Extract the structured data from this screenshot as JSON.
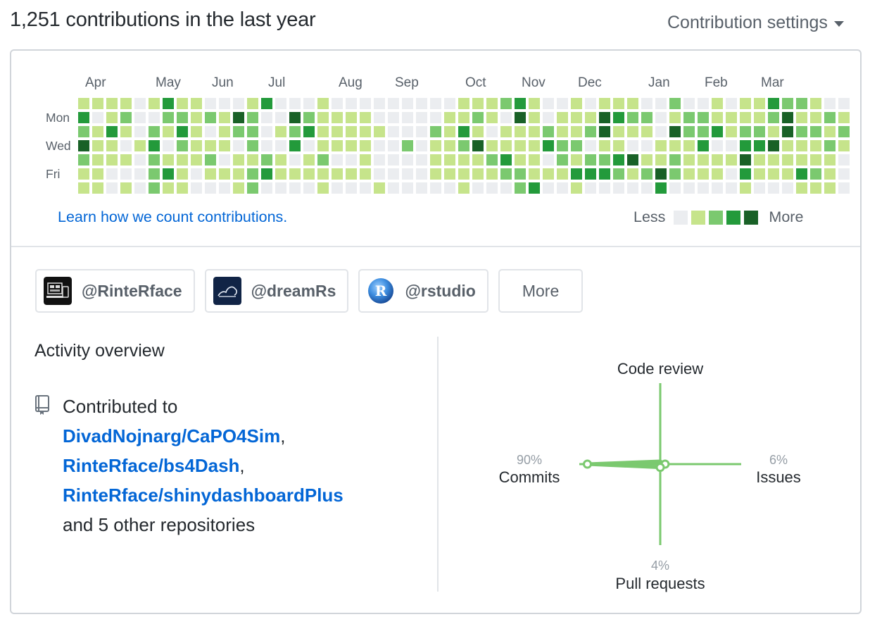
{
  "header": {
    "title": "1,251 contributions in the last year",
    "settings_label": "Contribution settings"
  },
  "calendar": {
    "months": [
      {
        "label": "Apr",
        "week": 1
      },
      {
        "label": "May",
        "week": 6
      },
      {
        "label": "Jun",
        "week": 10
      },
      {
        "label": "Jul",
        "week": 14
      },
      {
        "label": "Aug",
        "week": 19
      },
      {
        "label": "Sep",
        "week": 23
      },
      {
        "label": "Oct",
        "week": 28
      },
      {
        "label": "Nov",
        "week": 32
      },
      {
        "label": "Dec",
        "week": 36
      },
      {
        "label": "Jan",
        "week": 41
      },
      {
        "label": "Feb",
        "week": 45
      },
      {
        "label": "Mar",
        "week": 49
      }
    ],
    "day_labels": [
      {
        "label": "Mon",
        "row": 1
      },
      {
        "label": "Wed",
        "row": 3
      },
      {
        "label": "Fri",
        "row": 5
      }
    ],
    "level_colors": [
      "#ebedf0",
      "#c6e48b",
      "#7bc96f",
      "#239a3b",
      "#196127"
    ],
    "weeks": [
      [
        1,
        3,
        2,
        4,
        2,
        1,
        1
      ],
      [
        1,
        0,
        1,
        1,
        1,
        1,
        1
      ],
      [
        1,
        1,
        3,
        1,
        1,
        0,
        0
      ],
      [
        1,
        2,
        1,
        0,
        1,
        0,
        1
      ],
      [
        0,
        0,
        0,
        1,
        0,
        0,
        0
      ],
      [
        1,
        0,
        2,
        3,
        2,
        2,
        2
      ],
      [
        3,
        2,
        1,
        0,
        1,
        3,
        1
      ],
      [
        1,
        2,
        3,
        2,
        1,
        1,
        1
      ],
      [
        1,
        1,
        1,
        1,
        1,
        0,
        0
      ],
      [
        0,
        2,
        0,
        1,
        2,
        1,
        0
      ],
      [
        0,
        1,
        1,
        1,
        0,
        1,
        0
      ],
      [
        0,
        4,
        2,
        0,
        1,
        1,
        1
      ],
      [
        1,
        2,
        2,
        2,
        1,
        2,
        2
      ],
      [
        3,
        0,
        0,
        0,
        2,
        3,
        0
      ],
      [
        0,
        0,
        1,
        0,
        1,
        1,
        0
      ],
      [
        0,
        4,
        2,
        3,
        0,
        1,
        0
      ],
      [
        0,
        2,
        3,
        0,
        1,
        1,
        0
      ],
      [
        1,
        1,
        1,
        1,
        2,
        1,
        1
      ],
      [
        0,
        1,
        1,
        1,
        0,
        1,
        0
      ],
      [
        0,
        1,
        1,
        1,
        0,
        1,
        0
      ],
      [
        0,
        1,
        1,
        1,
        1,
        1,
        0
      ],
      [
        0,
        0,
        1,
        0,
        0,
        0,
        1
      ],
      [
        0,
        0,
        0,
        0,
        0,
        0,
        0
      ],
      [
        0,
        0,
        0,
        2,
        0,
        0,
        0
      ],
      [
        0,
        0,
        0,
        0,
        0,
        0,
        0
      ],
      [
        0,
        0,
        2,
        1,
        1,
        1,
        0
      ],
      [
        0,
        1,
        1,
        1,
        1,
        1,
        0
      ],
      [
        1,
        1,
        3,
        2,
        1,
        1,
        1
      ],
      [
        1,
        2,
        1,
        4,
        1,
        1,
        0
      ],
      [
        1,
        1,
        0,
        1,
        2,
        1,
        0
      ],
      [
        2,
        0,
        1,
        1,
        3,
        2,
        0
      ],
      [
        3,
        4,
        1,
        1,
        1,
        2,
        2
      ],
      [
        1,
        1,
        1,
        1,
        1,
        1,
        3
      ],
      [
        0,
        0,
        2,
        3,
        0,
        1,
        0
      ],
      [
        0,
        1,
        1,
        2,
        2,
        1,
        0
      ],
      [
        1,
        1,
        1,
        2,
        1,
        3,
        1
      ],
      [
        0,
        1,
        2,
        0,
        2,
        3,
        0
      ],
      [
        1,
        4,
        4,
        1,
        2,
        3,
        0
      ],
      [
        1,
        3,
        1,
        1,
        3,
        2,
        0
      ],
      [
        1,
        2,
        1,
        0,
        4,
        1,
        0
      ],
      [
        0,
        2,
        1,
        0,
        1,
        2,
        0
      ],
      [
        0,
        0,
        0,
        1,
        1,
        4,
        3
      ],
      [
        2,
        1,
        4,
        1,
        2,
        2,
        0
      ],
      [
        0,
        2,
        2,
        1,
        1,
        1,
        0
      ],
      [
        0,
        2,
        2,
        3,
        1,
        1,
        0
      ],
      [
        1,
        1,
        3,
        0,
        1,
        1,
        0
      ],
      [
        0,
        1,
        1,
        0,
        1,
        0,
        0
      ],
      [
        1,
        1,
        2,
        3,
        4,
        3,
        1
      ],
      [
        1,
        1,
        2,
        3,
        1,
        1,
        0
      ],
      [
        3,
        2,
        1,
        4,
        1,
        1,
        0
      ],
      [
        2,
        4,
        4,
        1,
        1,
        1,
        0
      ],
      [
        2,
        1,
        2,
        1,
        1,
        3,
        1
      ],
      [
        1,
        1,
        2,
        1,
        1,
        2,
        1
      ],
      [
        0,
        2,
        1,
        2,
        1,
        1,
        1
      ],
      [
        0,
        1,
        2,
        1,
        0,
        0,
        0
      ]
    ]
  },
  "footer_row": {
    "learn_link": "Learn how we count contributions.",
    "less_label": "Less",
    "more_label": "More"
  },
  "orgs": [
    {
      "label": "@RinteRface",
      "avatar": "rinterface-avatar"
    },
    {
      "label": "@dreamRs",
      "avatar": "dreamrs-avatar"
    },
    {
      "label": "@rstudio",
      "avatar": "rstudio-avatar"
    }
  ],
  "orgs_more_label": "More",
  "activity": {
    "title": "Activity overview",
    "contributed_to": "Contributed to",
    "repos": [
      "DivadNojnarg/CaPO4Sim",
      "RinteRface/bs4Dash",
      "RinteRface/shinydashboardPlus"
    ],
    "other_text": "and 5 other repositories",
    "icon": "repo-icon"
  },
  "radar": {
    "axes": [
      {
        "label": "Code review",
        "percent": "",
        "value": 0
      },
      {
        "label": "Issues",
        "percent": "6%",
        "value": 6
      },
      {
        "label": "Pull requests",
        "percent": "4%",
        "value": 4
      },
      {
        "label": "Commits",
        "percent": "90%",
        "value": 90
      }
    ],
    "color": "#7bc96f"
  }
}
